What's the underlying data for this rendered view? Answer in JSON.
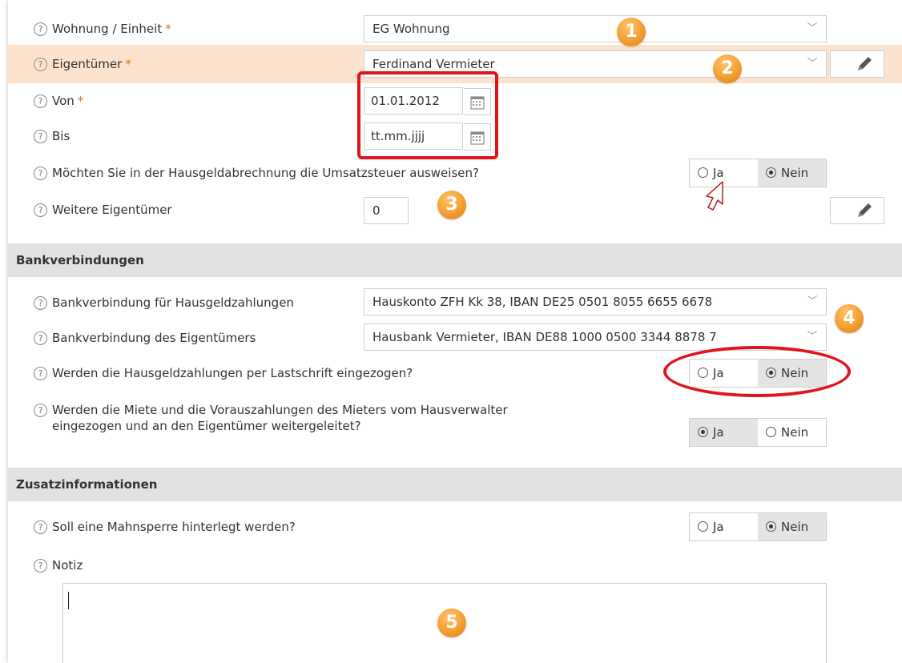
{
  "fields": {
    "wohnung": {
      "label": "Wohnung / Einheit",
      "required": "*",
      "value": "EG Wohnung"
    },
    "eigentuemer": {
      "label": "Eigentümer",
      "required": "*",
      "value": "Ferdinand Vermieter"
    },
    "von": {
      "label": "Von",
      "required": "*",
      "value": "01.01.2012"
    },
    "bis": {
      "label": "Bis",
      "placeholder": "tt.mm.jjjj"
    },
    "umsatzsteuer": {
      "label": "Möchten Sie in der Hausgeldabrechnung die Umsatzsteuer ausweisen?",
      "selected": "Nein"
    },
    "weitere": {
      "label": "Weitere Eigentümer",
      "value": "0"
    }
  },
  "bank": {
    "section_title": "Bankverbindungen",
    "hausgeld": {
      "label": "Bankverbindung für Hausgeldzahlungen",
      "value": "Hauskonto ZFH Kk 38, IBAN DE25 0501 8055 6655 6678"
    },
    "eigentuemer": {
      "label": "Bankverbindung des Eigentümers",
      "value": "Hausbank Vermieter, IBAN DE88 1000 0500 3344 8878 7"
    },
    "lastschrift": {
      "label": "Werden die Hausgeldzahlungen per Lastschrift eingezogen?",
      "selected": "Nein"
    },
    "miete": {
      "label_line1": "Werden die Miete und die Vorauszahlungen des Mieters vom Hausverwalter",
      "label_line2": "eingezogen und an den Eigentümer weitergeleitet?",
      "selected": "Ja"
    }
  },
  "zusatz": {
    "section_title": "Zusatzinformationen",
    "mahnsperre": {
      "label": "Soll eine Mahnsperre hinterlegt werden?",
      "selected": "Nein"
    },
    "notiz": {
      "label": "Notiz",
      "value": ""
    }
  },
  "radio_options": {
    "yes": "Ja",
    "no": "Nein"
  },
  "help_symbol": "?",
  "badges": [
    "1",
    "2",
    "3",
    "4",
    "5"
  ],
  "icons": {
    "help": "help-circle-icon",
    "dropdown": "chevron-down-icon",
    "edit": "pencil-icon",
    "calendar": "calendar-icon",
    "cursor": "mouse-pointer-icon"
  },
  "colors": {
    "highlight_row": "#fde3cd",
    "required": "#e8720c",
    "badge": "#f6a53a",
    "annotation": "#e0141c",
    "section_bg": "#e2e2e2",
    "selected_radio_bg": "#e4e4e4"
  }
}
